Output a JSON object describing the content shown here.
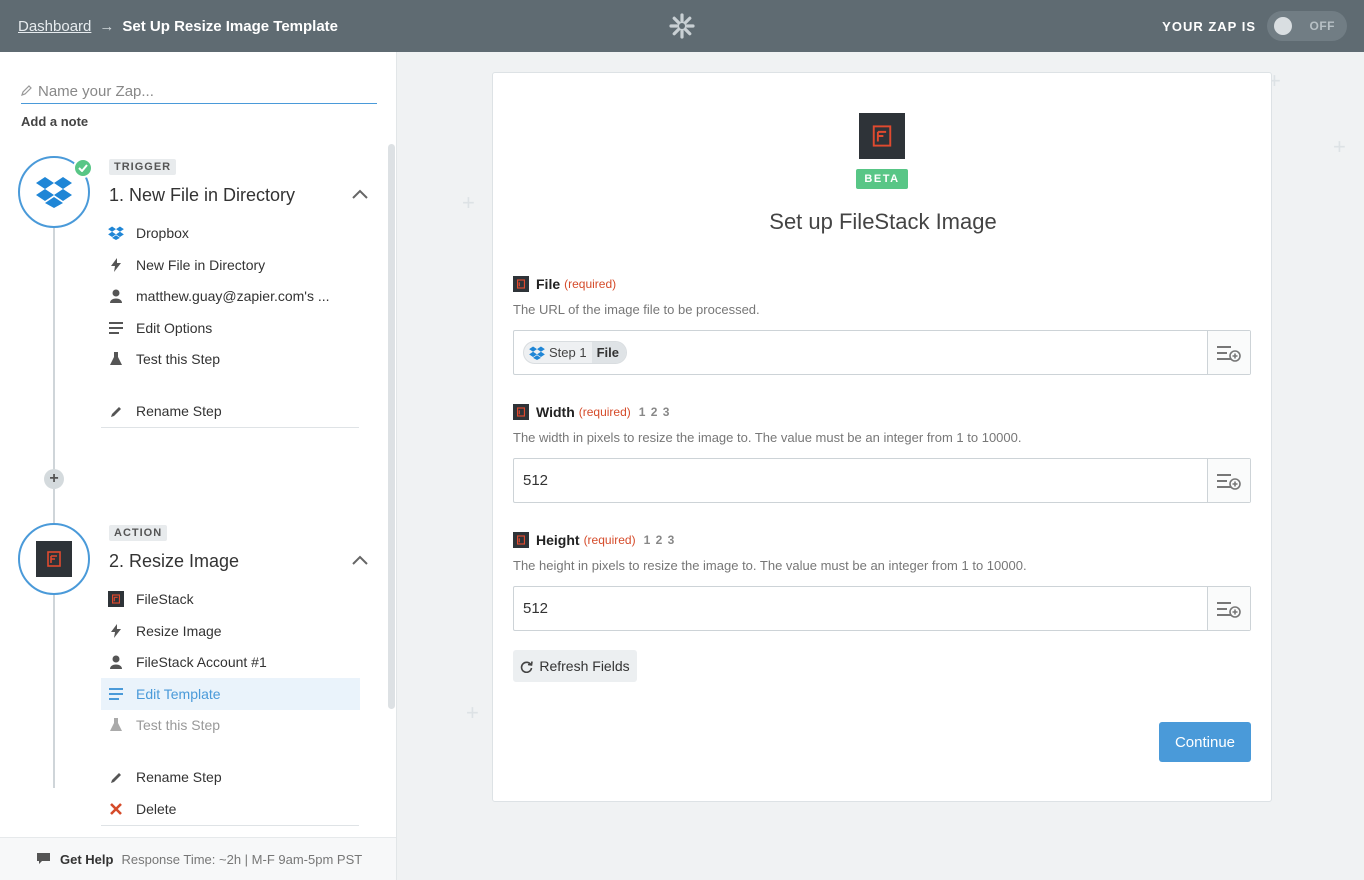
{
  "header": {
    "breadcrumb_link": "Dashboard",
    "arrow": "→",
    "title": "Set Up Resize Image Template",
    "zap_status_label": "YOUR ZAP IS",
    "toggle_label": "OFF"
  },
  "sidebar": {
    "name_placeholder": "Name your Zap...",
    "add_note": "Add a note",
    "steps": [
      {
        "tag": "TRIGGER",
        "title": "1. New File in Directory",
        "items": [
          {
            "label": "Dropbox",
            "icon": "dropbox-icon"
          },
          {
            "label": "New File in Directory",
            "icon": "bolt-icon"
          },
          {
            "label": "matthew.guay@zapier.com's ...",
            "icon": "user-icon"
          },
          {
            "label": "Edit Options",
            "icon": "lines-icon"
          },
          {
            "label": "Test this Step",
            "icon": "flask-icon"
          },
          {
            "label": "Rename Step",
            "icon": "pencil-icon"
          }
        ]
      },
      {
        "tag": "ACTION",
        "title": "2. Resize Image",
        "items": [
          {
            "label": "FileStack",
            "icon": "filestack-icon"
          },
          {
            "label": "Resize Image",
            "icon": "bolt-icon"
          },
          {
            "label": "FileStack Account #1",
            "icon": "user-icon"
          },
          {
            "label": "Edit Template",
            "icon": "lines-icon"
          },
          {
            "label": "Test this Step",
            "icon": "flask-icon"
          },
          {
            "label": "Rename Step",
            "icon": "pencil-icon"
          },
          {
            "label": "Delete",
            "icon": "x-icon"
          }
        ]
      }
    ],
    "help": {
      "label": "Get Help",
      "response": "Response Time: ~2h | M-F 9am-5pm PST"
    }
  },
  "card": {
    "badge": "BETA",
    "title": "Set up FileStack Image",
    "fields": [
      {
        "label": "File",
        "required": "(required)",
        "nums": "",
        "help": "The URL of the image file to be processed.",
        "pill_step": "Step 1",
        "pill_field": "File",
        "value": ""
      },
      {
        "label": "Width",
        "required": "(required)",
        "nums": "1 2 3",
        "help": "The width in pixels to resize the image to. The value must be an integer from 1 to 10000.",
        "value": "512"
      },
      {
        "label": "Height",
        "required": "(required)",
        "nums": "1 2 3",
        "help": "The height in pixels to resize the image to. The value must be an integer from 1 to 10000.",
        "value": "512"
      }
    ],
    "refresh_label": "Refresh Fields",
    "continue_label": "Continue"
  },
  "colors": {
    "accent": "#4a9ad9",
    "success": "#58c686",
    "danger": "#d54b2a",
    "topbar": "#5f6b72"
  }
}
